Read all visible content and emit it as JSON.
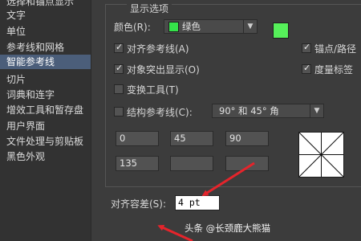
{
  "sidebar": {
    "items": [
      {
        "label": "选择和锚点显示"
      },
      {
        "label": "文字"
      },
      {
        "label": "单位"
      },
      {
        "label": "参考线和网格"
      },
      {
        "label": "智能参考线"
      },
      {
        "label": "切片"
      },
      {
        "label": "词典和连字"
      },
      {
        "label": "增效工具和暂存盘"
      },
      {
        "label": "用户界面"
      },
      {
        "label": "文件处理与剪贴板"
      },
      {
        "label": "黑色外观"
      }
    ],
    "selected_index": 4
  },
  "display": {
    "title": "显示选项",
    "color_label": "颜色(R):",
    "color_value": "绿色",
    "color_hex": "#56f05a",
    "align_guides": {
      "label": "对齐参考线(A)",
      "checked": true
    },
    "anchor_path": {
      "label": "锚点/路径",
      "checked": true
    },
    "object_highlight": {
      "label": "对象突出显示(O)",
      "checked": true
    },
    "measure_label": {
      "label": "度量标签",
      "checked": true
    },
    "transform_tools": {
      "label": "变换工具(T)",
      "checked": false
    },
    "construction_guides": {
      "label": "结构参考线(C):",
      "checked": false
    },
    "angle_preset": "90° 和 45° 角",
    "angles": [
      "0",
      "45",
      "90",
      "135",
      "",
      ""
    ]
  },
  "tolerance": {
    "label": "对齐容差(S):",
    "value": "4 pt"
  },
  "watermark": "头条 @长颈鹿大熊猫",
  "colors": {
    "selected_bg": "#4b5e7a",
    "arrow": "#e5242b"
  }
}
